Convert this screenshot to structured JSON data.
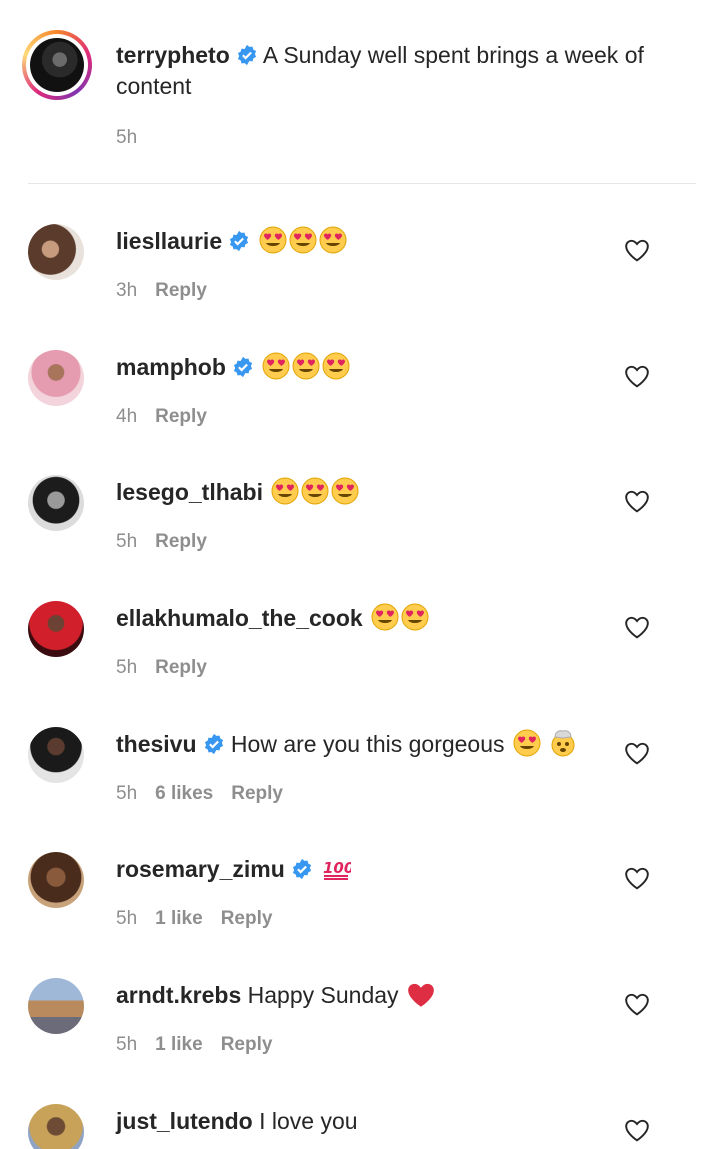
{
  "caption": {
    "username": "terrypheto",
    "text": "A Sunday well spent brings a week of content",
    "time": "5h"
  },
  "icons": {
    "verified": "verified-badge-icon",
    "heart": "heart-outline-icon",
    "heart_eyes": "heart-eyes-emoji",
    "exploding_head": "exploding-head-emoji",
    "hundred": "hundred-points-emoji",
    "red_heart": "red-heart-emoji"
  },
  "colors": {
    "verified_blue": "#3897f0",
    "meta_gray": "#8e8e8e",
    "text": "#262626"
  },
  "comments": [
    {
      "username": "liesllaurie",
      "text": "",
      "time": "3h",
      "likes": "",
      "reply": "Reply"
    },
    {
      "username": "mamphob",
      "text": "",
      "time": "4h",
      "likes": "",
      "reply": "Reply"
    },
    {
      "username": "lesego_tlhabi",
      "text": "",
      "time": "5h",
      "likes": "",
      "reply": "Reply"
    },
    {
      "username": "ellakhumalo_the_cook",
      "text": "",
      "time": "5h",
      "likes": "",
      "reply": "Reply"
    },
    {
      "username": "thesivu",
      "text": "How are you this gorgeous",
      "time": "5h",
      "likes": "6 likes",
      "reply": "Reply"
    },
    {
      "username": "rosemary_zimu",
      "text": "",
      "time": "5h",
      "likes": "1 like",
      "reply": "Reply"
    },
    {
      "username": "arndt.krebs",
      "text": "Happy Sunday",
      "time": "5h",
      "likes": "1 like",
      "reply": "Reply"
    },
    {
      "username": "just_lutendo",
      "text": "I love you",
      "time": "",
      "likes": "",
      "reply": ""
    }
  ]
}
